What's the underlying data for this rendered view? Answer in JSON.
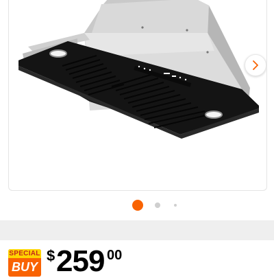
{
  "gallery": {
    "image_alt": "Black range hood insert with stainless steel housing",
    "current_slide": 1,
    "total_slides": 3,
    "next_icon": "chevron-right-icon"
  },
  "badge": {
    "line1": "SPECIAL",
    "line2": "BUY"
  },
  "price": {
    "currency": "$",
    "dollars": "259",
    "cents": "00"
  },
  "colors": {
    "accent": "#f96302",
    "badge_yellow": "#ffd400",
    "badge_red_text": "#c2261c",
    "dot_inactive": "#cfcfcf"
  }
}
